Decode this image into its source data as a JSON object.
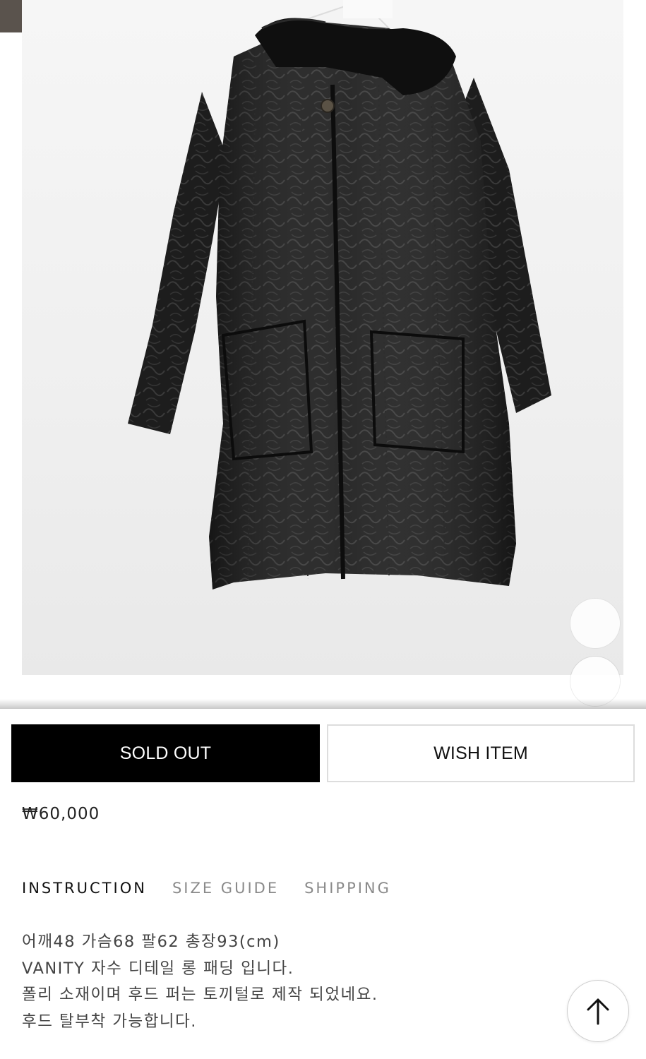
{
  "product": {
    "image_alt": "Black quilted long padded coat with fur-trimmed hood on hanger",
    "price": "₩60,000"
  },
  "actions": {
    "sold_out_label": "SOLD OUT",
    "wish_label": "WISH ITEM"
  },
  "tabs": [
    {
      "label": "INSTRUCTION",
      "active": true
    },
    {
      "label": "SIZE GUIDE",
      "active": false
    },
    {
      "label": "SHIPPING",
      "active": false
    }
  ],
  "description": [
    "어깨48 가슴68 팔62 총장93(cm)",
    "VANITY 자수 디테일 롱 패딩 입니다.",
    "폴리 소재이며 후드 퍼는 토끼털로 제작 되었네요.",
    "후드 탈부착 가능합니다."
  ],
  "icons": {
    "scroll_top": "arrow-up-icon"
  },
  "colors": {
    "sold_out_bg": "#000000",
    "accent_text": "#111111",
    "muted_tab": "#8a8a8a"
  }
}
